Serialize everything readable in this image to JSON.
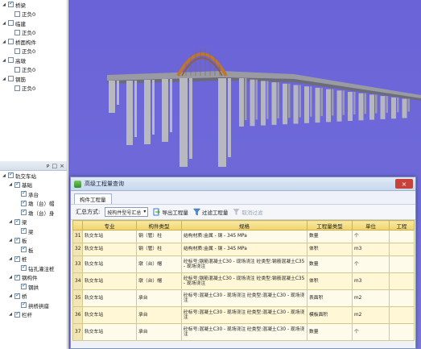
{
  "left_top_tree": [
    {
      "label": "桥梁",
      "level": 0,
      "checked": true,
      "expanded": true
    },
    {
      "label": "正负0",
      "level": 1,
      "checked": false
    },
    {
      "label": "临建",
      "level": 0,
      "checked": false,
      "expanded": true
    },
    {
      "label": "正负0",
      "level": 1,
      "checked": false
    },
    {
      "label": "桥面构件",
      "level": 0,
      "checked": false,
      "expanded": true
    },
    {
      "label": "正负0",
      "level": 1,
      "checked": false
    },
    {
      "label": "高墩",
      "level": 0,
      "checked": false,
      "expanded": true
    },
    {
      "label": "正负0",
      "level": 1,
      "checked": false
    },
    {
      "label": "钢筋",
      "level": 0,
      "checked": false,
      "expanded": true
    },
    {
      "label": "正负0",
      "level": 1,
      "checked": false
    }
  ],
  "left_panel_buttons": [
    "ᴘ",
    "□",
    "×"
  ],
  "left_bottom_tree": [
    {
      "label": "轨交车站",
      "level": 0,
      "checked": true
    },
    {
      "label": "基础",
      "level": 1,
      "checked": true
    },
    {
      "label": "承台",
      "level": 2,
      "checked": true
    },
    {
      "label": "墩（台）帽",
      "level": 2,
      "checked": true
    },
    {
      "label": "墩（台）身",
      "level": 2,
      "checked": true
    },
    {
      "label": "梁",
      "level": 1,
      "checked": true
    },
    {
      "label": "梁",
      "level": 2,
      "checked": true
    },
    {
      "label": "板",
      "level": 1,
      "checked": true
    },
    {
      "label": "板",
      "level": 2,
      "checked": true
    },
    {
      "label": "桩",
      "level": 1,
      "checked": true
    },
    {
      "label": "钻孔灌注桩",
      "level": 2,
      "checked": true
    },
    {
      "label": "钢构件",
      "level": 1,
      "checked": true
    },
    {
      "label": "钢拱",
      "level": 2,
      "checked": true
    },
    {
      "label": "桥",
      "level": 1,
      "checked": true
    },
    {
      "label": "拱桥拱座",
      "level": 2,
      "checked": true
    },
    {
      "label": "栏杆",
      "level": 1,
      "checked": true
    }
  ],
  "dialog": {
    "title": "高级工程量查询",
    "close_label": "×",
    "tab": "构件工程量",
    "summary_label": "汇总方式:",
    "summary_value": "按构件型号汇总",
    "export_label": "导出工程量",
    "filter_label": "过滤工程量",
    "cancel_filter_label": "取消过滤"
  },
  "table": {
    "headers": [
      "",
      "专业",
      "构件类型",
      "规格",
      "工程量类型",
      "单位",
      "工程"
    ],
    "rows": [
      {
        "no": "31",
        "major": "轨交车站",
        "type": "钢（管）柱",
        "spec": "结构材质:金属 - 钢 - 345 MPa",
        "qtype": "数量",
        "unit": "个"
      },
      {
        "no": "32",
        "major": "轨交车站",
        "type": "钢（管）柱",
        "spec": "结构材质:金属 - 钢 - 345 MPa",
        "qtype": "体积",
        "unit": "m3"
      },
      {
        "no": "33",
        "major": "轨交车站",
        "type": "墩（台）帽",
        "spec": "砼标号:钢筋混凝土C30 - 现场浇注  砼类型:钢筋混凝土C35 - 现场浇注",
        "qtype": "数量",
        "unit": "个"
      },
      {
        "no": "34",
        "major": "轨交车站",
        "type": "墩（台）帽",
        "spec": "砼标号:钢筋混凝土C30 - 现场浇注  砼类型:钢筋混凝土C35 - 现场浇注",
        "qtype": "体积",
        "unit": "m3"
      },
      {
        "no": "35",
        "major": "轨交车站",
        "type": "承台",
        "spec": "砼标号:混凝土C30 - 现场浇注  砼类型:混凝土C30 - 现场浇注",
        "qtype": "表面积",
        "unit": "m2"
      },
      {
        "no": "36",
        "major": "轨交车站",
        "type": "承台",
        "spec": "砼标号:混凝土C30 - 现场浇注  砼类型:混凝土C30 - 现场浇注",
        "qtype": "模板面积",
        "unit": "m2"
      },
      {
        "no": "37",
        "major": "轨交车站",
        "type": "承台",
        "spec": "砼标号:混凝土C30 - 现场浇注  砼类型:混凝土C30 - 现场浇注",
        "qtype": "数量",
        "unit": "个"
      }
    ]
  },
  "colors": {
    "viewport_bg": "#6f6ad9",
    "arch": "#c0762c",
    "header_yellow": "#efd36a"
  }
}
